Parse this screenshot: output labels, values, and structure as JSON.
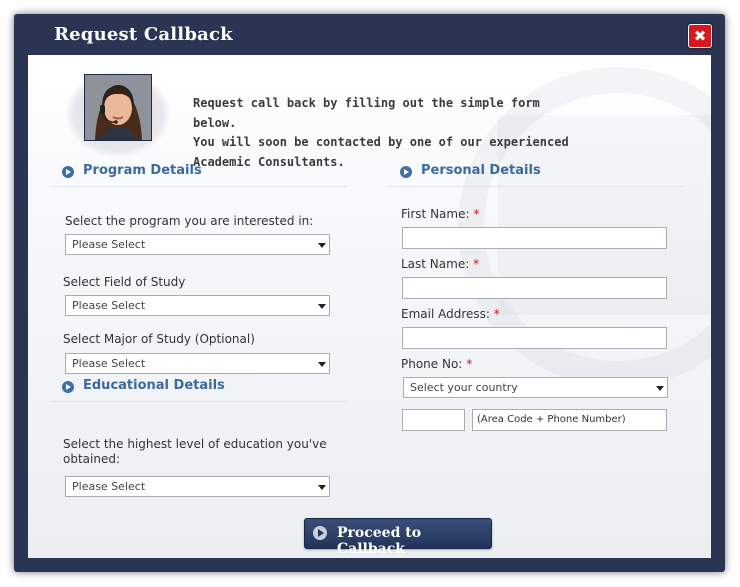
{
  "dialog": {
    "title": "Request Callback",
    "close_label": "✖"
  },
  "intro": {
    "line1": "Request call back by filling out the simple form below.",
    "line2": "You will soon be contacted by one of our experienced",
    "line3": "Academic Consultants."
  },
  "program_details": {
    "heading": "Program Details",
    "program_label": "Select the program you are interested in:",
    "program_value": "Please Select",
    "field_label": "Select Field of Study",
    "field_value": "Please Select",
    "major_label": "Select Major of Study (Optional)",
    "major_value": "Please Select"
  },
  "educational_details": {
    "heading": "Educational Details",
    "education_label_line1": "Select the highest level of education you've",
    "education_label_line2": "obtained:",
    "education_value": "Please Select"
  },
  "personal_details": {
    "heading": "Personal Details",
    "first_name_label": "First Name:",
    "last_name_label": "Last Name:",
    "email_label": "Email Address:",
    "phone_label": "Phone No:",
    "required_mark": "*",
    "country_value": "Select your country",
    "country_code_value": "",
    "phone_number_value": "(Area Code + Phone Number)"
  },
  "actions": {
    "proceed_label": "Proceed to Callback"
  },
  "colors": {
    "frame": "#2a3553",
    "close": "#d8171e",
    "section_heading": "#3b6aa0",
    "required": "#c8161e"
  }
}
